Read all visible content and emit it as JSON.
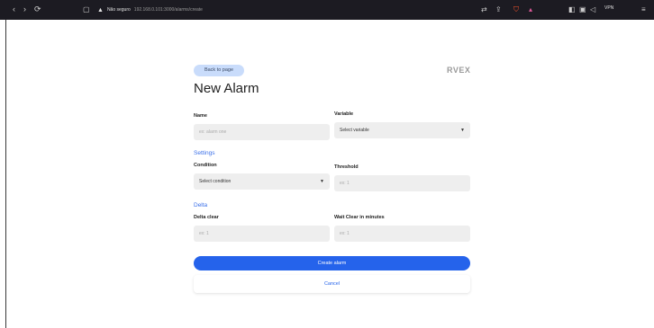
{
  "browser": {
    "nav_back": "‹",
    "nav_forward": "›",
    "reload": "⟳",
    "bookmark": "▢",
    "security_text": "Não seguro",
    "url": "192.168.0.101:3000/alarms/create",
    "vpn": "VPN"
  },
  "page": {
    "back_label": "Back to page",
    "logo": "RVEX",
    "title": "New Alarm"
  },
  "form": {
    "name_label": "Name",
    "name_placeholder": "ex: alarm one",
    "variable_label": "Variable",
    "variable_value": "Select variable",
    "settings_section": "Settings",
    "condition_label": "Condition",
    "condition_value": "Select condition",
    "threshold_label": "Threshold",
    "threshold_placeholder": "ex: 1",
    "delta_section": "Delta",
    "delta_clear_label": "Delta clear",
    "delta_clear_placeholder": "ex: 1",
    "wait_clear_label": "Wait Clear in minutes",
    "wait_clear_placeholder": "ex: 1",
    "submit_label": "Create alarm",
    "cancel_label": "Cancel"
  },
  "colors": {
    "accent": "#2563eb",
    "back_button_bg": "#c9dcfb",
    "input_bg": "#eeeeee",
    "chrome_bg": "#1c1b22"
  }
}
